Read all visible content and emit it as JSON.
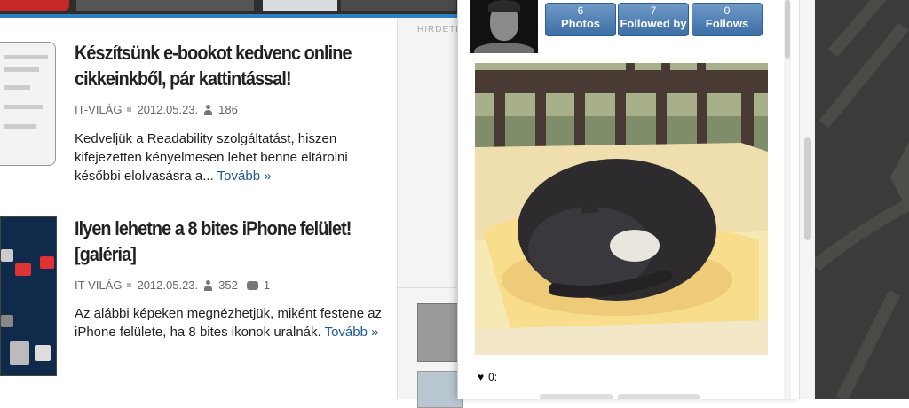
{
  "articles": [
    {
      "title": "Készítsünk e-bookot kedvenc online cikkeinkből, pár kattintással!",
      "source": "IT-VILÁG",
      "date": "2012.05.23.",
      "views": "186",
      "excerpt": "Kedveljük a Readability szolgáltatást, hiszen kifejezetten kényelmesen lehet benne eltárolni későbbi elolvasásra a...",
      "more": "Tovább »"
    },
    {
      "title": "Ilyen lehetne a 8 bites iPhone felület! [galéria]",
      "source": "IT-VILÁG",
      "date": "2012.05.23.",
      "views": "352",
      "comments": "1",
      "excerpt": "Az alábbi képeken megnézhetjük, miként festene az iPhone felülete, ha 8 bites ikonok uralnák.",
      "more": "Tovább »"
    }
  ],
  "sidebar": {
    "ad_label": "HIRDETÉ"
  },
  "popup": {
    "stats": [
      {
        "count": "6",
        "label": "Photos"
      },
      {
        "count": "7",
        "label": "Followed by"
      },
      {
        "count": "0",
        "label": "Follows"
      }
    ],
    "likes": "0:"
  },
  "colors": {
    "accent": "#2f7fc3",
    "link": "#1d5a99",
    "stat_button": "#4a7bb0",
    "dark_background": "#3b3b39"
  }
}
